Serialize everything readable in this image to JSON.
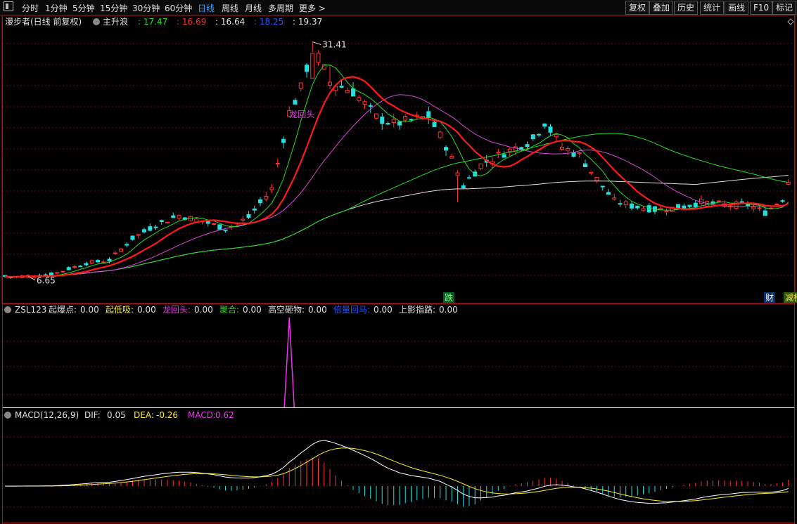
{
  "toolbar": {
    "window_icon": "window-icon",
    "periods": [
      "分时",
      "1分钟",
      "5分钟",
      "15分钟",
      "30分钟",
      "60分钟",
      "日线",
      "周线",
      "月线",
      "多周期",
      "更多 >"
    ],
    "active_period": "日线",
    "right_buttons": [
      "复权",
      "叠加",
      "历史",
      "统计",
      "画线",
      "F10",
      "标记"
    ]
  },
  "main_panel": {
    "title": "漫步者(日线 前复权)",
    "indicator_name": "主升浪",
    "ma_values": [
      {
        "value": ": 17.47",
        "color": "#22dd22"
      },
      {
        "value": ": 16.69",
        "color": "#ff3333"
      },
      {
        "value": ": 16.64",
        "color": "#e0e0e0"
      },
      {
        "value": ": 18.25",
        "color": "#2255ff"
      },
      {
        "value": ": 19.37",
        "color": "#e0e0e0"
      }
    ],
    "high_label": "31.41",
    "low_label": "6.65",
    "signal_label": "龙回头",
    "event_labels": [
      {
        "text": "跌",
        "bg": "#0a5a2a",
        "fg": "#7fff7f"
      },
      {
        "text": "财",
        "bg": "#0b2f6b",
        "fg": "#ffffff"
      },
      {
        "text": "减榜",
        "bg": "#2a5a10",
        "fg": "#ffdd44"
      }
    ],
    "y_range": [
      5,
      33
    ]
  },
  "zsl_panel": {
    "name": "ZSL123",
    "items": [
      {
        "label": "起爆点:",
        "value": "0.00",
        "color": "#e0e0e0"
      },
      {
        "label": "起低吸:",
        "value": "0.00",
        "color": "#ffee22"
      },
      {
        "label": "龙回头:",
        "value": "0.00",
        "color": "#ee33ee"
      },
      {
        "label": "聚合:",
        "value": "0.00",
        "color": "#22dd22"
      },
      {
        "label": "高空砸物:",
        "value": "0.00",
        "color": "#e0e0e0"
      },
      {
        "label": "倍量回马:",
        "value": "0.00",
        "color": "#2255ff"
      },
      {
        "label": "上影指路:",
        "value": "0.00",
        "color": "#e0e0e0"
      }
    ]
  },
  "macd_panel": {
    "title": "MACD(12,26,9)",
    "dif": {
      "label": "DIF:",
      "value": "0.05",
      "color": "#e0e0e0"
    },
    "dea": {
      "label": "DEA:",
      "value": "-0.26",
      "color": "#ffee22"
    },
    "macd": {
      "label": "MACD:",
      "value": "0.62",
      "color": "#ee33ee"
    }
  },
  "colors": {
    "up": "#ff3333",
    "down": "#22e0e0",
    "ma_red": "#ff1a1a",
    "ma_green": "#22dd22",
    "ma_magenta": "#dd44dd",
    "ma_white": "#dddddd",
    "grid": "#5a1010",
    "frame": "#aa1a1a"
  }
}
